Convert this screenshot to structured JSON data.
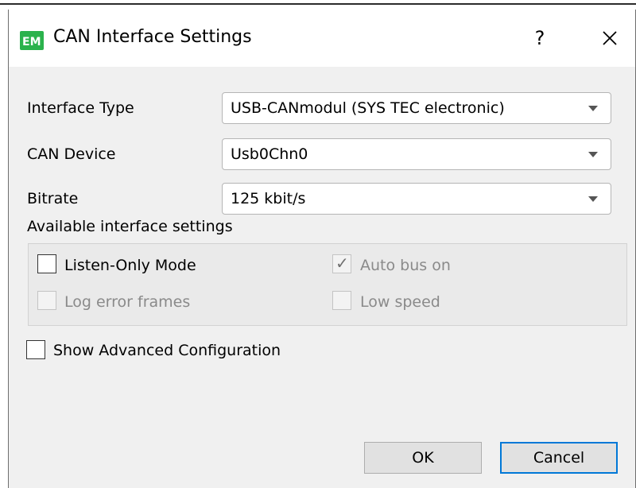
{
  "window": {
    "title": "CAN Interface Settings",
    "icon_text": "EM",
    "help_label": "?",
    "close_icon": "close-icon"
  },
  "form": {
    "interface_type": {
      "label": "Interface Type",
      "value": "USB-CANmodul (SYS TEC electronic)"
    },
    "can_device": {
      "label": "CAN Device",
      "value": "Usb0Chn0"
    },
    "bitrate": {
      "label": "Bitrate",
      "value": "125 kbit/s"
    }
  },
  "settings": {
    "heading": "Available interface settings",
    "listen_only": {
      "label": "Listen-Only Mode",
      "checked": false,
      "enabled": true
    },
    "auto_bus_on": {
      "label": "Auto bus on",
      "checked": true,
      "enabled": false
    },
    "log_error_frames": {
      "label": "Log error frames",
      "checked": false,
      "enabled": false
    },
    "low_speed": {
      "label": "Low speed",
      "checked": false,
      "enabled": false
    }
  },
  "advanced": {
    "label": "Show Advanced Configuration",
    "checked": false
  },
  "buttons": {
    "ok": "OK",
    "cancel": "Cancel"
  },
  "colors": {
    "icon_bg": "#2bb24c",
    "default_button_border": "#0078d7",
    "dialog_bg": "#f0f0f0"
  }
}
